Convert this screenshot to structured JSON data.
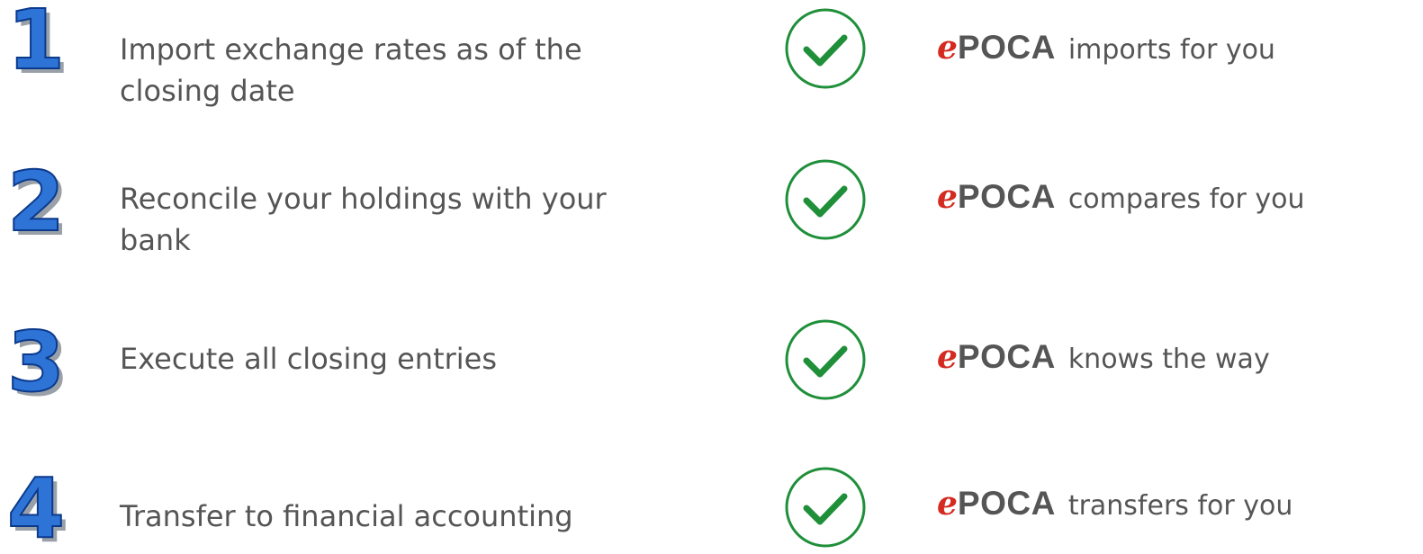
{
  "colors": {
    "number_fill": "#2e74d6",
    "number_outline": "#0b3a8c",
    "number_shadow": "#9aa0a8",
    "task_text": "#555555",
    "check_ring": "#1f8f3a",
    "logo_e": "#d42a20",
    "logo_text": "#555555"
  },
  "brand": {
    "logo_prefix": "e",
    "logo_name": "POCA"
  },
  "steps": [
    {
      "number": "1",
      "task": "Import exchange rates as of the closing date",
      "check_icon": "checkmark-circle-icon",
      "claim": "imports for you"
    },
    {
      "number": "2",
      "task": "Reconcile your holdings with your bank",
      "check_icon": "checkmark-circle-icon",
      "claim": "compares for you"
    },
    {
      "number": "3",
      "task": "Execute all closing entries",
      "check_icon": "checkmark-circle-icon",
      "claim": "knows the way"
    },
    {
      "number": "4",
      "task": "Transfer to financial accounting",
      "check_icon": "checkmark-circle-icon",
      "claim": "transfers for you"
    }
  ]
}
